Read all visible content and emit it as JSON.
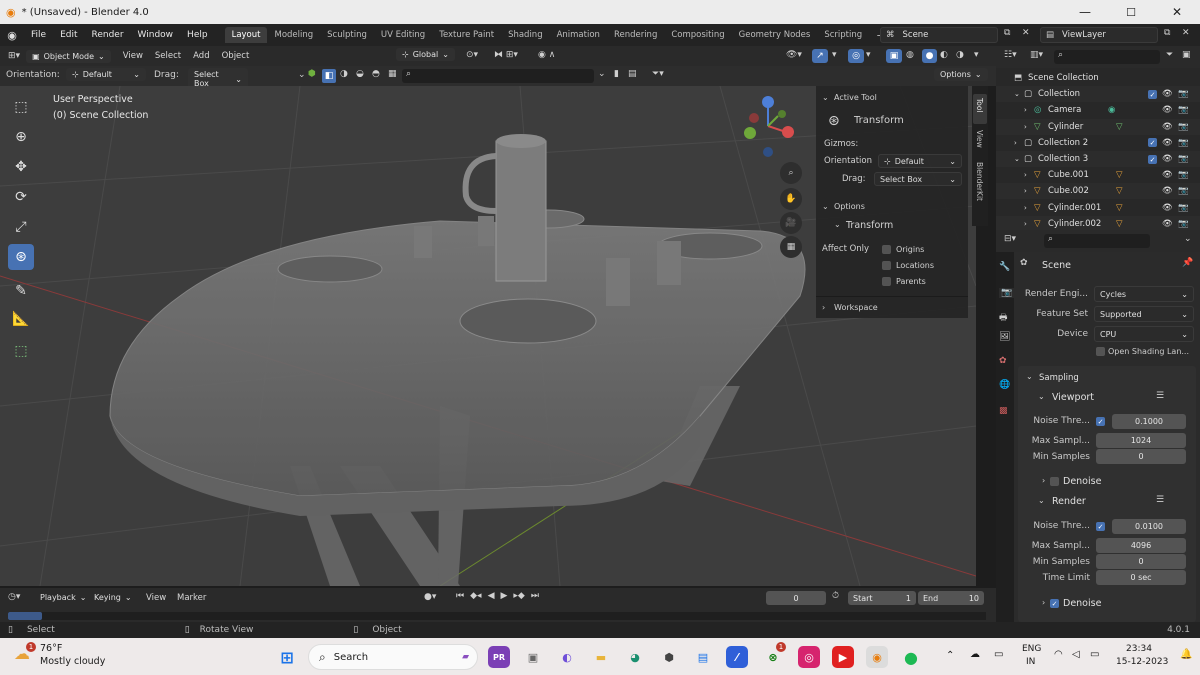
{
  "window": {
    "title": "* (Unsaved) - Blender 4.0"
  },
  "menu": {
    "items": [
      "File",
      "Edit",
      "Render",
      "Window",
      "Help"
    ]
  },
  "workspaces": [
    "Layout",
    "Modeling",
    "Sculpting",
    "UV Editing",
    "Texture Paint",
    "Shading",
    "Animation",
    "Rendering",
    "Compositing",
    "Geometry Nodes",
    "Scripting"
  ],
  "scene_field": "Scene",
  "viewlayer_field": "ViewLayer",
  "header": {
    "mode": "Object Mode",
    "view": "View",
    "select": "Select",
    "add": "Add",
    "object": "Object",
    "transform_orientation": "Global"
  },
  "header2": {
    "orientation_label": "Orientation:",
    "orientation_value": "Default",
    "drag_label": "Drag:",
    "drag_value": "Select Box",
    "options": "Options"
  },
  "viewport": {
    "line1": "User Perspective",
    "line2": "(0) Scene Collection"
  },
  "npanel": {
    "tabs": [
      "Tool",
      "View",
      "BlenderKit"
    ],
    "active_tool_header": "Active Tool",
    "active_tool": "Transform",
    "gizmos": "Gizmos:",
    "orientation_label": "Orientation",
    "orientation_value": "Default",
    "drag_label": "Drag:",
    "drag_value": "Select Box",
    "options_header": "Options",
    "transform_header": "Transform",
    "affect_only": "Affect Only",
    "affect_items": [
      "Origins",
      "Locations",
      "Parents"
    ],
    "workspace_header": "Workspace"
  },
  "outliner": {
    "rows": [
      {
        "label": "Scene Collection",
        "indent": 0
      },
      {
        "label": "Collection",
        "indent": 1
      },
      {
        "label": "Camera",
        "indent": 2
      },
      {
        "label": "Cylinder",
        "indent": 2
      },
      {
        "label": "Collection 2",
        "indent": 1
      },
      {
        "label": "Collection 3",
        "indent": 1
      },
      {
        "label": "Cube.001",
        "indent": 2
      },
      {
        "label": "Cube.002",
        "indent": 2
      },
      {
        "label": "Cylinder.001",
        "indent": 2
      },
      {
        "label": "Cylinder.002",
        "indent": 2
      }
    ]
  },
  "properties": {
    "context": "Scene",
    "render_engine_label": "Render Engi...",
    "render_engine": "Cycles",
    "feature_set_label": "Feature Set",
    "feature_set": "Supported",
    "device_label": "Device",
    "device": "CPU",
    "osl": "Open Shading Lan...",
    "sampling": "Sampling",
    "viewport_panel": "Viewport",
    "vp_noise_label": "Noise Thre...",
    "vp_noise": "0.1000",
    "vp_max_label": "Max Sampl...",
    "vp_max": "1024",
    "vp_min_label": "Min Samples",
    "vp_min": "0",
    "vp_denoise": "Denoise",
    "render_panel": "Render",
    "r_noise_label": "Noise Thre...",
    "r_noise": "0.0100",
    "r_max_label": "Max Sampl...",
    "r_max": "4096",
    "r_min_label": "Min Samples",
    "r_min": "0",
    "time_limit_label": "Time Limit",
    "time_limit": "0 sec",
    "r_denoise": "Denoise"
  },
  "timeline": {
    "playback": "Playback",
    "keying": "Keying",
    "view": "View",
    "marker": "Marker",
    "current_frame": "0",
    "start_label": "Start",
    "start": "1",
    "end_label": "End",
    "end": "10"
  },
  "status": {
    "select": "Select",
    "rotate": "Rotate View",
    "object": "Object",
    "version": "4.0.1"
  },
  "taskbar": {
    "temp": "76°F",
    "weather": "Mostly cloudy",
    "search": "Search",
    "lang1": "ENG",
    "lang2": "IN",
    "time": "23:34",
    "date": "15-12-2023",
    "weather_badge": "1",
    "notify_badge": "1"
  }
}
